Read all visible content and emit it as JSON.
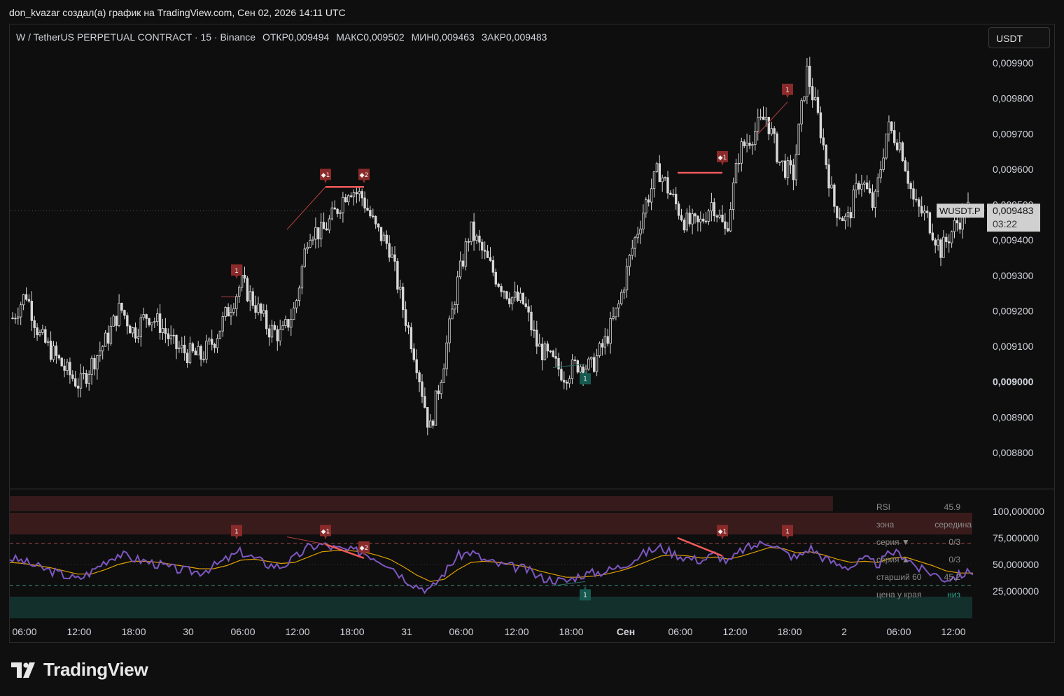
{
  "header": {
    "author_line": "don_kvazar создал(а) график на TradingView.com, Сен 02, 2026 14:11 UTC"
  },
  "legend": {
    "symbol": "W / TetherUS PERPETUAL CONTRACT · 15 · Binance",
    "open": "ОТКР0,009494",
    "high": "МАКС0,009502",
    "low": "МИН0,009463",
    "close": "ЗАКР0,009483"
  },
  "currency_button": "USDT",
  "brand": "TradingView",
  "chart_data": [
    {
      "type": "candlestick",
      "symbol": "WUSDT.P",
      "timeframe": "15",
      "exchange": "Binance",
      "ylim": [
        0.00872,
        0.00995
      ],
      "y_ticks": [
        "0,009900",
        "0,009800",
        "0,009700",
        "0,009600",
        "0,009500",
        "0,009400",
        "0,009300",
        "0,009200",
        "0,009100",
        "0,009000",
        "0,008900",
        "0,008800"
      ],
      "x_ticks": [
        "06:00",
        "12:00",
        "18:00",
        "30",
        "06:00",
        "12:00",
        "18:00",
        "31",
        "06:00",
        "12:00",
        "18:00",
        "Сен",
        "06:00",
        "12:00",
        "18:00",
        "2",
        "06:00",
        "12:00"
      ],
      "last_price_label": "0,009483",
      "last_price": 0.009483,
      "countdown": "03:22",
      "symbol_tag": "WUSDT.P",
      "close_path": [
        0.00918,
        0.00925,
        0.00913,
        0.00908,
        0.00903,
        0.00899,
        0.00906,
        0.00912,
        0.00921,
        0.00914,
        0.00919,
        0.00916,
        0.0091,
        0.00908,
        0.00907,
        0.00912,
        0.0092,
        0.00928,
        0.00922,
        0.00915,
        0.00913,
        0.00921,
        0.00943,
        0.00942,
        0.00948,
        0.00955,
        0.00952,
        0.00943,
        0.00938,
        0.00921,
        0.00906,
        0.00886,
        0.00905,
        0.00927,
        0.00943,
        0.00936,
        0.00929,
        0.00924,
        0.00922,
        0.0091,
        0.00906,
        0.00902,
        0.00905,
        0.00904,
        0.00911,
        0.00921,
        0.00937,
        0.0095,
        0.0096,
        0.00952,
        0.00945,
        0.00944,
        0.00951,
        0.00942,
        0.00965,
        0.0097,
        0.00975,
        0.00962,
        0.00958,
        0.00988,
        0.00972,
        0.0095,
        0.00945,
        0.00958,
        0.00949,
        0.00972,
        0.00967,
        0.0095,
        0.00946,
        0.00937,
        0.00944,
        0.00949
      ],
      "markers": [
        {
          "label": "1",
          "kind": "bear",
          "value": 0.00928
        },
        {
          "label": "◆1",
          "kind": "bear",
          "value": 0.00955
        },
        {
          "label": "◆2",
          "kind": "bear",
          "value": 0.00955
        },
        {
          "label": "1",
          "kind": "bull",
          "value": 0.00905
        },
        {
          "label": "◆1",
          "kind": "bear",
          "value": 0.0096
        },
        {
          "label": "1",
          "kind": "bear",
          "value": 0.00979
        }
      ]
    },
    {
      "type": "line",
      "name": "RSI",
      "y_ticks": [
        "100,000000",
        "75,000000",
        "50,000000",
        "25,000000"
      ],
      "levels": [
        70,
        30
      ],
      "series": [
        {
          "values": [
            56,
            53,
            48,
            44,
            40,
            36,
            43,
            53,
            60,
            56,
            53,
            50,
            46,
            44,
            43,
            48,
            55,
            62,
            56,
            50,
            48,
            56,
            66,
            69,
            65,
            63,
            62,
            56,
            50,
            38,
            30,
            26,
            42,
            58,
            62,
            54,
            50,
            48,
            46,
            38,
            36,
            34,
            40,
            42,
            44,
            48,
            55,
            62,
            66,
            60,
            56,
            54,
            60,
            52,
            64,
            68,
            72,
            62,
            56,
            66,
            56,
            50,
            48,
            55,
            50,
            62,
            58,
            46,
            42,
            36,
            40,
            44
          ]
        },
        {
          "values": [
            52,
            51,
            49,
            47,
            44,
            41,
            41,
            45,
            50,
            53,
            53,
            52,
            50,
            48,
            46,
            46,
            49,
            54,
            55,
            53,
            51,
            52,
            57,
            62,
            63,
            63,
            62,
            59,
            55,
            48,
            40,
            34,
            36,
            45,
            52,
            53,
            52,
            50,
            48,
            44,
            41,
            38,
            38,
            39,
            41,
            44,
            48,
            53,
            58,
            59,
            58,
            56,
            57,
            55,
            58,
            62,
            66,
            65,
            61,
            62,
            59,
            55,
            52,
            53,
            52,
            56,
            57,
            53,
            49,
            44,
            42,
            42
          ]
        }
      ],
      "markers": [
        {
          "label": "1",
          "kind": "bear",
          "value": 62
        },
        {
          "label": "◆1",
          "kind": "bear",
          "value": 69
        },
        {
          "label": "◆2",
          "kind": "bear",
          "value": 56
        },
        {
          "label": "1",
          "kind": "bull",
          "value": 34
        },
        {
          "label": "◆1",
          "kind": "bear",
          "value": 62
        },
        {
          "label": "1",
          "kind": "bear",
          "value": 62
        }
      ]
    }
  ],
  "rsi_table": [
    {
      "label": "RSI",
      "value": "45.9"
    },
    {
      "label": "зона",
      "value": "середина"
    },
    {
      "label": "серия ▼",
      "value": "0/3"
    },
    {
      "label": "серия ▲",
      "value": "0/3"
    },
    {
      "label": "старший 60",
      "value": "45.2"
    },
    {
      "label": "цена у края",
      "value": "низ"
    }
  ],
  "colors": {
    "bear_marker": "#8b2a2a",
    "bull_marker": "#16594f",
    "divergence": "#f05a5a",
    "rsi_line": "#7e57c2",
    "rsi_ma": "#e0a000",
    "candles": "#d8d8d8",
    "zone_top": "#3a1b1b",
    "zone_bottom": "#13302c"
  }
}
